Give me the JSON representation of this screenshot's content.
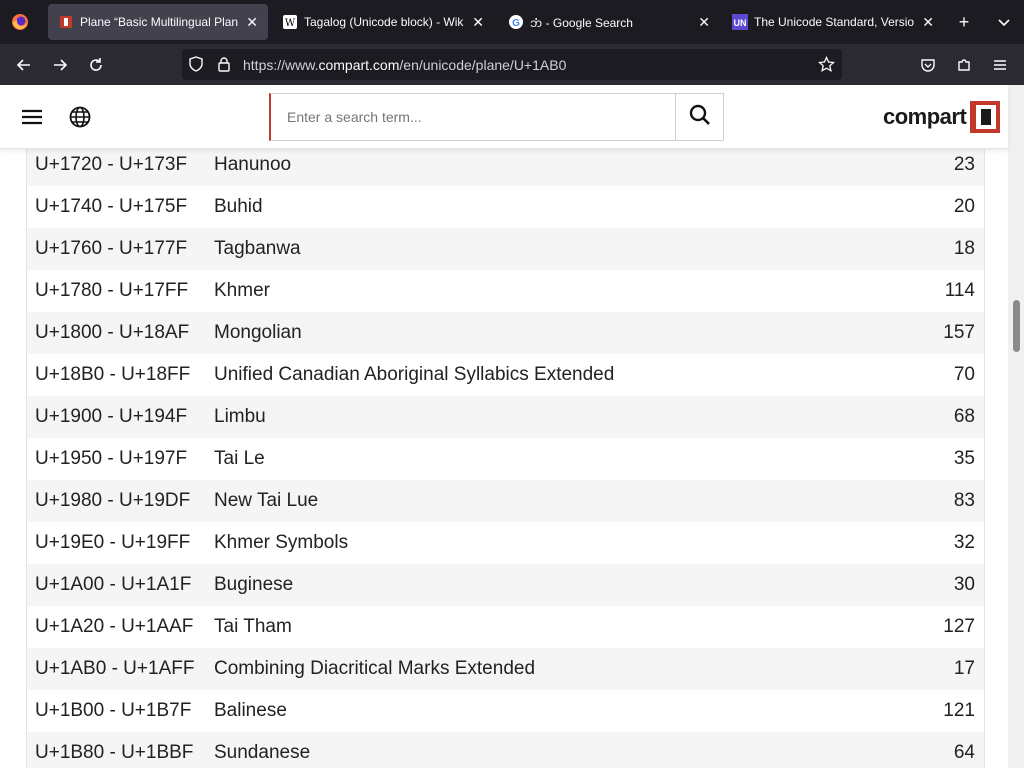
{
  "browser": {
    "tabs": [
      {
        "title": "Plane “Basic Multilingual Plane”",
        "active": true,
        "favicon": "compart-icon"
      },
      {
        "title": "Tagalog (Unicode block) - Wikip",
        "active": false,
        "favicon": "wikipedia-icon"
      },
      {
        "title": "𑄃𑄁 - Google Search",
        "active": false,
        "favicon": "google-icon"
      },
      {
        "title": "The Unicode Standard, Version",
        "active": false,
        "favicon": "unicode-icon"
      }
    ],
    "url_prefix": "https://www.",
    "url_domain": "compart.com",
    "url_path": "/en/unicode/plane/U+1AB0"
  },
  "site": {
    "search_placeholder": "Enter a search term...",
    "logo_text": "compart"
  },
  "blocks": [
    {
      "range": "U+1720 - U+173F",
      "name": "Hanunoo",
      "count": "23"
    },
    {
      "range": "U+1740 - U+175F",
      "name": "Buhid",
      "count": "20"
    },
    {
      "range": "U+1760 - U+177F",
      "name": "Tagbanwa",
      "count": "18"
    },
    {
      "range": "U+1780 - U+17FF",
      "name": "Khmer",
      "count": "114"
    },
    {
      "range": "U+1800 - U+18AF",
      "name": "Mongolian",
      "count": "157"
    },
    {
      "range": "U+18B0 - U+18FF",
      "name": "Unified Canadian Aboriginal Syllabics Extended",
      "count": "70"
    },
    {
      "range": "U+1900 - U+194F",
      "name": "Limbu",
      "count": "68"
    },
    {
      "range": "U+1950 - U+197F",
      "name": "Tai Le",
      "count": "35"
    },
    {
      "range": "U+1980 - U+19DF",
      "name": "New Tai Lue",
      "count": "83"
    },
    {
      "range": "U+19E0 - U+19FF",
      "name": "Khmer Symbols",
      "count": "32"
    },
    {
      "range": "U+1A00 - U+1A1F",
      "name": "Buginese",
      "count": "30"
    },
    {
      "range": "U+1A20 - U+1AAF",
      "name": "Tai Tham",
      "count": "127"
    },
    {
      "range": "U+1AB0 - U+1AFF",
      "name": "Combining Diacritical Marks Extended",
      "count": "17"
    },
    {
      "range": "U+1B00 - U+1B7F",
      "name": "Balinese",
      "count": "121"
    },
    {
      "range": "U+1B80 - U+1BBF",
      "name": "Sundanese",
      "count": "64"
    }
  ]
}
